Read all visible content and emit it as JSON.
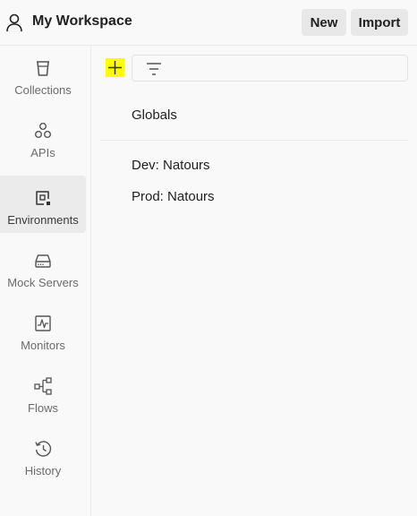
{
  "header": {
    "workspace_title": "My Workspace",
    "new_label": "New",
    "import_label": "Import",
    "workspace_icon": "user-icon"
  },
  "sidebar": {
    "active_item": "Environments",
    "items": [
      {
        "label": "Collections",
        "icon": "trash-bin-icon"
      },
      {
        "label": "APIs",
        "icon": "api-nodes-icon"
      },
      {
        "label": "Environments",
        "icon": "environment-icon"
      },
      {
        "label": "Mock Servers",
        "icon": "server-icon"
      },
      {
        "label": "Monitors",
        "icon": "monitor-pulse-icon"
      },
      {
        "label": "Flows",
        "icon": "flows-icon"
      },
      {
        "label": "History",
        "icon": "history-icon"
      }
    ]
  },
  "main": {
    "add_icon": "plus-icon",
    "filter_icon": "filter-icon",
    "filter_placeholder": "",
    "globals_label": "Globals",
    "environments": [
      {
        "name": "Dev: Natours"
      },
      {
        "name": "Prod: Natours"
      }
    ]
  },
  "colors": {
    "background": "#f9f9f9",
    "active_nav": "#ebebeb",
    "button_bg": "#e8e8e8",
    "add_highlight": "#ffff00",
    "text_primary": "#212121",
    "text_secondary": "#6b6b6b"
  }
}
